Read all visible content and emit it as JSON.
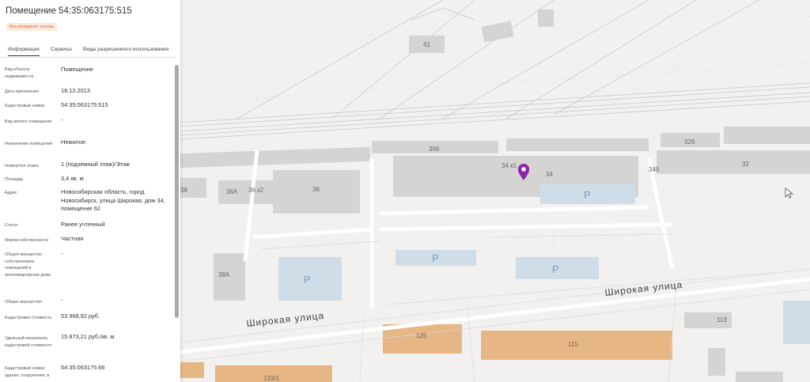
{
  "panel": {
    "title": "Помещение 54:35:063175:515",
    "badge": "Без координат границ",
    "tabs": [
      "Информация",
      "Сервисы",
      "Виды разрешенного использования"
    ],
    "fields": [
      {
        "label": "Вид объекта недвижимости",
        "value": "Помещение"
      },
      {
        "label": "Дата присвоения",
        "value": "18.12.2013"
      },
      {
        "label": "Кадастровый номер",
        "value": "54:35:063175:515"
      },
      {
        "label": "Вид жилого помещения",
        "value": "-"
      },
      {
        "label": "Назначение помещения",
        "value": "Нежилое"
      },
      {
        "label": "Номер/тип этажа",
        "value": "1 (подземный этаж)/Этаж"
      },
      {
        "label": "Площадь",
        "value": "3,4 кв. м"
      },
      {
        "label": "Адрес",
        "value": "Новосибирская область, город Новосибирск, улица Широкая, дом 34, помещение 62"
      },
      {
        "label": "Статус",
        "value": "Ранее учтенный"
      },
      {
        "label": "Форма собственности",
        "value": "Частная"
      },
      {
        "label": "Общее имущество собственников помещений в многоквартирном доме",
        "value": "-"
      },
      {
        "label": "Общее имущество",
        "value": "-"
      },
      {
        "label": "Кадастровая стоимость",
        "value": "53 968,92 руб."
      },
      {
        "label": "Удельный показатель кадастровой стоимости",
        "value": "15 873,21 руб./кв. м"
      },
      {
        "label": "Кадастровый номер здания, сооружения, в",
        "value": "54:35:063175:66"
      }
    ]
  },
  "map": {
    "street_labels": [
      "Широкая улица",
      "Широкая улица"
    ],
    "building_labels": [
      "41",
      "36б",
      "32б",
      "32",
      "34",
      "34",
      "34б",
      "36",
      "36А",
      "36 к2",
      "38",
      "38А",
      "125",
      "115",
      "113",
      "133/1"
    ],
    "parking_label": "P",
    "marker_color": "#8e24aa",
    "building_color": "#d5d4d2",
    "commercial_color": "#e6b784"
  }
}
